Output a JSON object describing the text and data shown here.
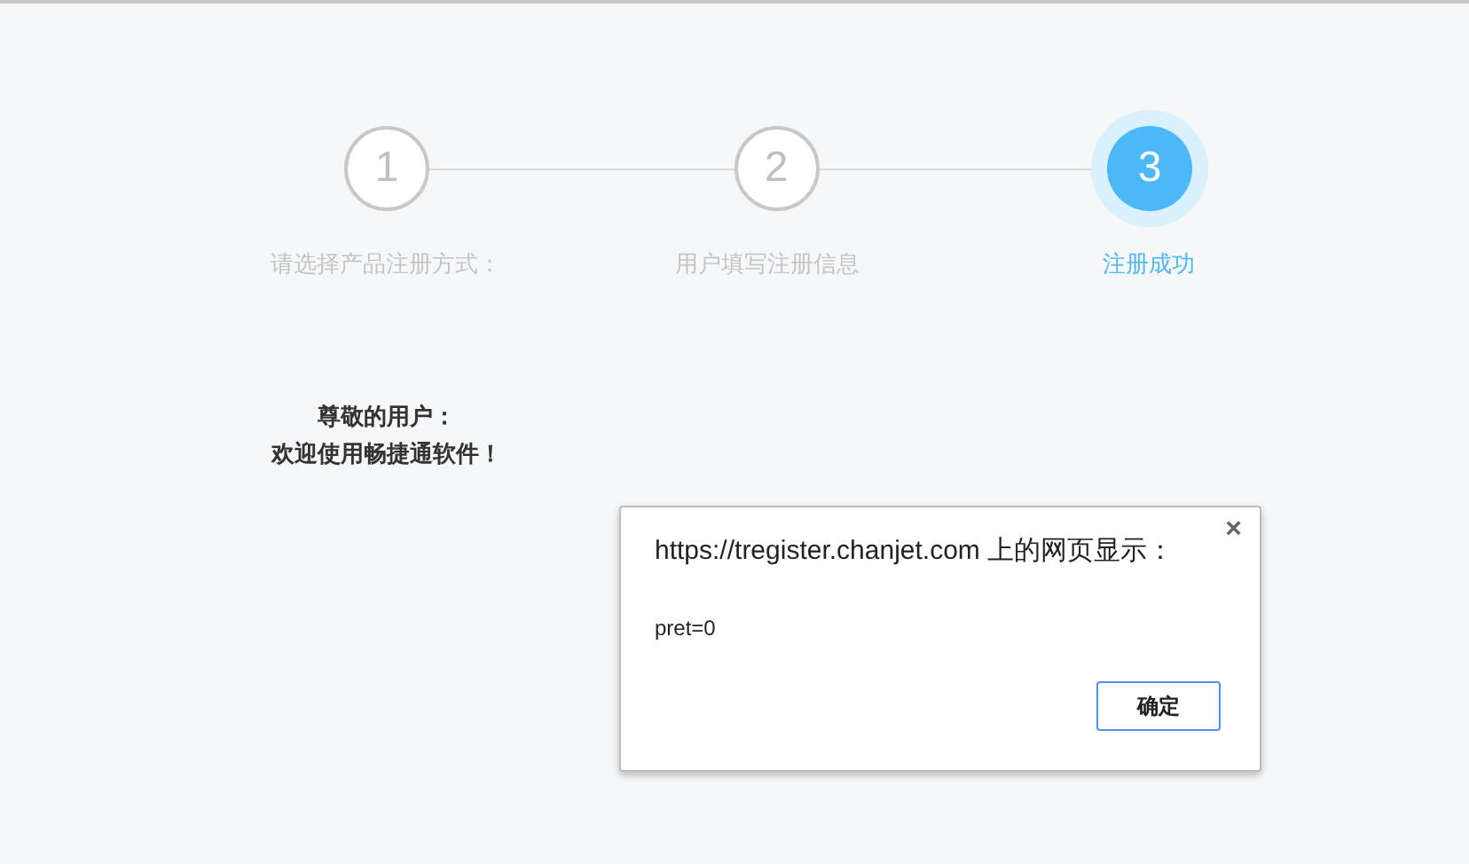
{
  "steps": [
    {
      "number": "1",
      "label": "请选择产品注册方式：",
      "active": false
    },
    {
      "number": "2",
      "label": "用户填写注册信息",
      "active": false
    },
    {
      "number": "3",
      "label": "注册成功",
      "active": true
    }
  ],
  "greeting": [
    "尊敬的用户：",
    "欢迎使用畅捷通软件！"
  ],
  "dialog": {
    "title": "https://tregister.chanjet.com 上的网页显示：",
    "close": "×",
    "message": "pret=0",
    "buttons": [
      "确定"
    ]
  }
}
